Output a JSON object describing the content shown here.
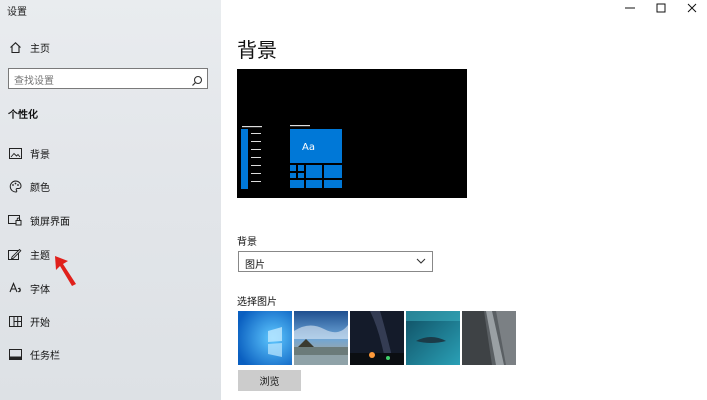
{
  "app": {
    "title": "设置"
  },
  "sidebar": {
    "home_label": "主页",
    "search_placeholder": "查找设置",
    "section_title": "个性化",
    "items": [
      {
        "label": "背景",
        "icon": "image-icon"
      },
      {
        "label": "颜色",
        "icon": "palette-icon"
      },
      {
        "label": "锁屏界面",
        "icon": "lock-screen-icon"
      },
      {
        "label": "主题",
        "icon": "theme-icon"
      },
      {
        "label": "字体",
        "icon": "font-icon"
      },
      {
        "label": "开始",
        "icon": "start-icon"
      },
      {
        "label": "任务栏",
        "icon": "taskbar-icon"
      }
    ]
  },
  "main": {
    "page_title": "背景",
    "preview_tile_text": "Aa",
    "background_label": "背景",
    "background_value": "图片",
    "choose_picture_label": "选择图片",
    "pictures": [
      {
        "name": "windows-blue"
      },
      {
        "name": "beach-sky"
      },
      {
        "name": "night-sky"
      },
      {
        "name": "underwater"
      },
      {
        "name": "rock-cliff"
      }
    ],
    "browse_label": "浏览"
  },
  "colors": {
    "accent": "#0078d7",
    "arrow": "#e0201b"
  }
}
